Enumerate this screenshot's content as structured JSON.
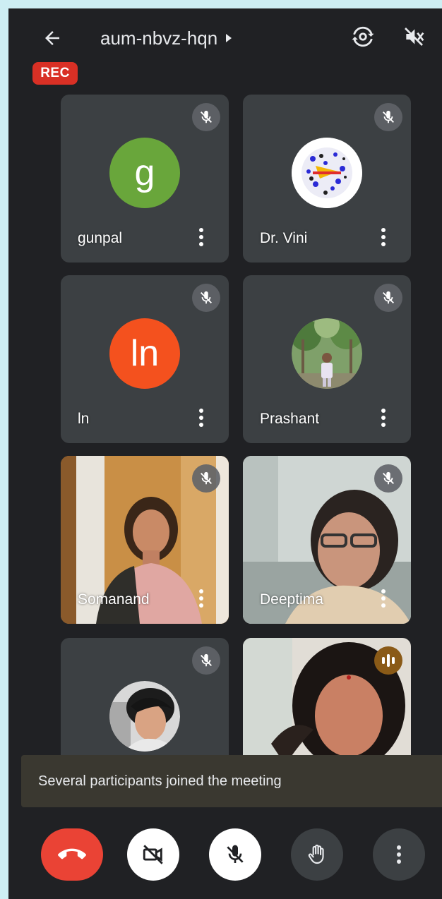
{
  "header": {
    "meeting_code": "aum-nbvz-hqn",
    "rec_label": "REC"
  },
  "participants": [
    {
      "name": "gunpal",
      "initial": "g",
      "avatar_color": "#69a63b",
      "muted": true
    },
    {
      "name": "Dr. Vini",
      "muted": true
    },
    {
      "name": "ln",
      "initial": "ln",
      "avatar_color": "#f4511e",
      "muted": true
    },
    {
      "name": "Prashant",
      "muted": true
    },
    {
      "name": "Somanand",
      "muted": true
    },
    {
      "name": "Deeptima",
      "muted": true
    },
    {
      "name": "",
      "muted": true
    },
    {
      "name": "",
      "speaking": true
    }
  ],
  "toast": {
    "message": "Several participants joined the meeting"
  },
  "colors": {
    "background": "#202124",
    "tile": "#3c4043",
    "end_call": "#ea4335",
    "rec": "#d93025"
  }
}
